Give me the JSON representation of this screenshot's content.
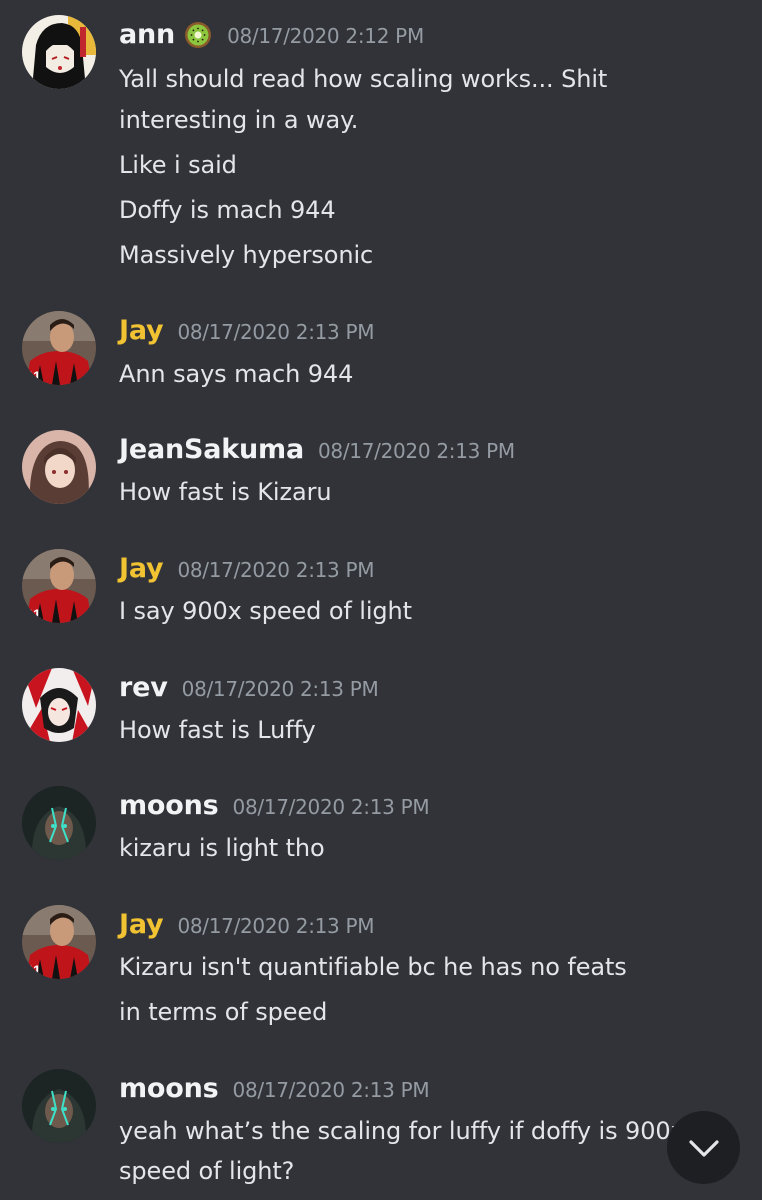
{
  "colors": {
    "background": "#313338",
    "text": "#e3e5e8",
    "timestamp": "#959ba3",
    "username_default": "#f2f3f5",
    "username_gold": "#f1c232"
  },
  "messages": [
    {
      "author": "ann",
      "badge_icon": "kiwi-icon",
      "timestamp": "08/17/2020 2:12 PM",
      "lines": [
        "Yall should read how scaling works... Shit",
        "interesting in a way.",
        "Like i said",
        "Doffy is mach 944",
        "Massively hypersonic"
      ]
    },
    {
      "author": "Jay",
      "timestamp": "08/17/2020 2:13 PM",
      "lines": [
        "Ann says mach 944"
      ]
    },
    {
      "author": "JeanSakuma",
      "timestamp": "08/17/2020 2:13 PM",
      "lines": [
        "How fast is Kizaru"
      ]
    },
    {
      "author": "Jay",
      "timestamp": "08/17/2020 2:13 PM",
      "lines": [
        "I say 900x speed of light"
      ]
    },
    {
      "author": "rev",
      "timestamp": "08/17/2020 2:13 PM",
      "lines": [
        "How fast is Luffy"
      ]
    },
    {
      "author": "moons",
      "timestamp": "08/17/2020 2:13 PM",
      "lines": [
        "kizaru is light tho"
      ]
    },
    {
      "author": "Jay",
      "timestamp": "08/17/2020 2:13 PM",
      "lines": [
        "Kizaru isn't quantifiable bc he has no feats",
        "in terms of speed"
      ]
    },
    {
      "author": "moons",
      "timestamp": "08/17/2020 2:13 PM",
      "lines": [
        "yeah what’s the scaling for luffy if doffy is 900x",
        "speed of light?"
      ]
    }
  ],
  "scroll_button": {
    "icon": "chevron-down-icon"
  }
}
